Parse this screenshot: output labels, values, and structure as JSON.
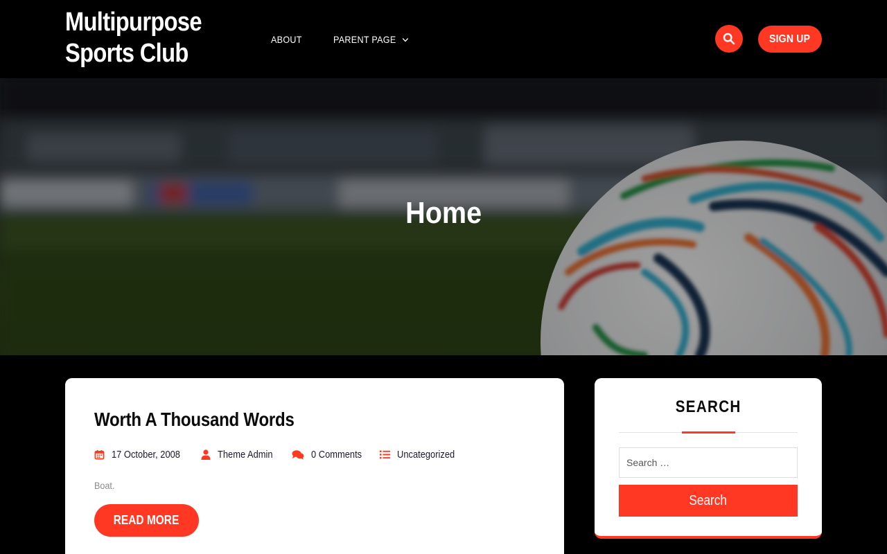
{
  "header": {
    "site_title_line1": "Multipurpose",
    "site_title_line2": "Sports Club",
    "nav": [
      {
        "label": "ABOUT"
      },
      {
        "label": "PARENT PAGE",
        "has_submenu": true
      }
    ],
    "search_icon": "search-icon",
    "signup_label": "SIGN UP"
  },
  "hero": {
    "title": "Home"
  },
  "post": {
    "title": "Worth A Thousand Words",
    "date": "17 October, 2008",
    "author": "Theme Admin",
    "comments": "0 Comments",
    "category": "Uncategorized",
    "excerpt": "Boat.",
    "read_more_label": "READ MORE",
    "icons": [
      "calendar-icon",
      "user-icon",
      "comments-icon",
      "list-icon"
    ]
  },
  "sidebar": {
    "search_widget": {
      "title": "SEARCH",
      "placeholder": "Search …",
      "button_label": "Search"
    }
  },
  "colors": {
    "accent": "#ff3823",
    "header_bg": "#000000",
    "card_bg": "#ffffff",
    "text_dark": "#0b0b0b"
  }
}
